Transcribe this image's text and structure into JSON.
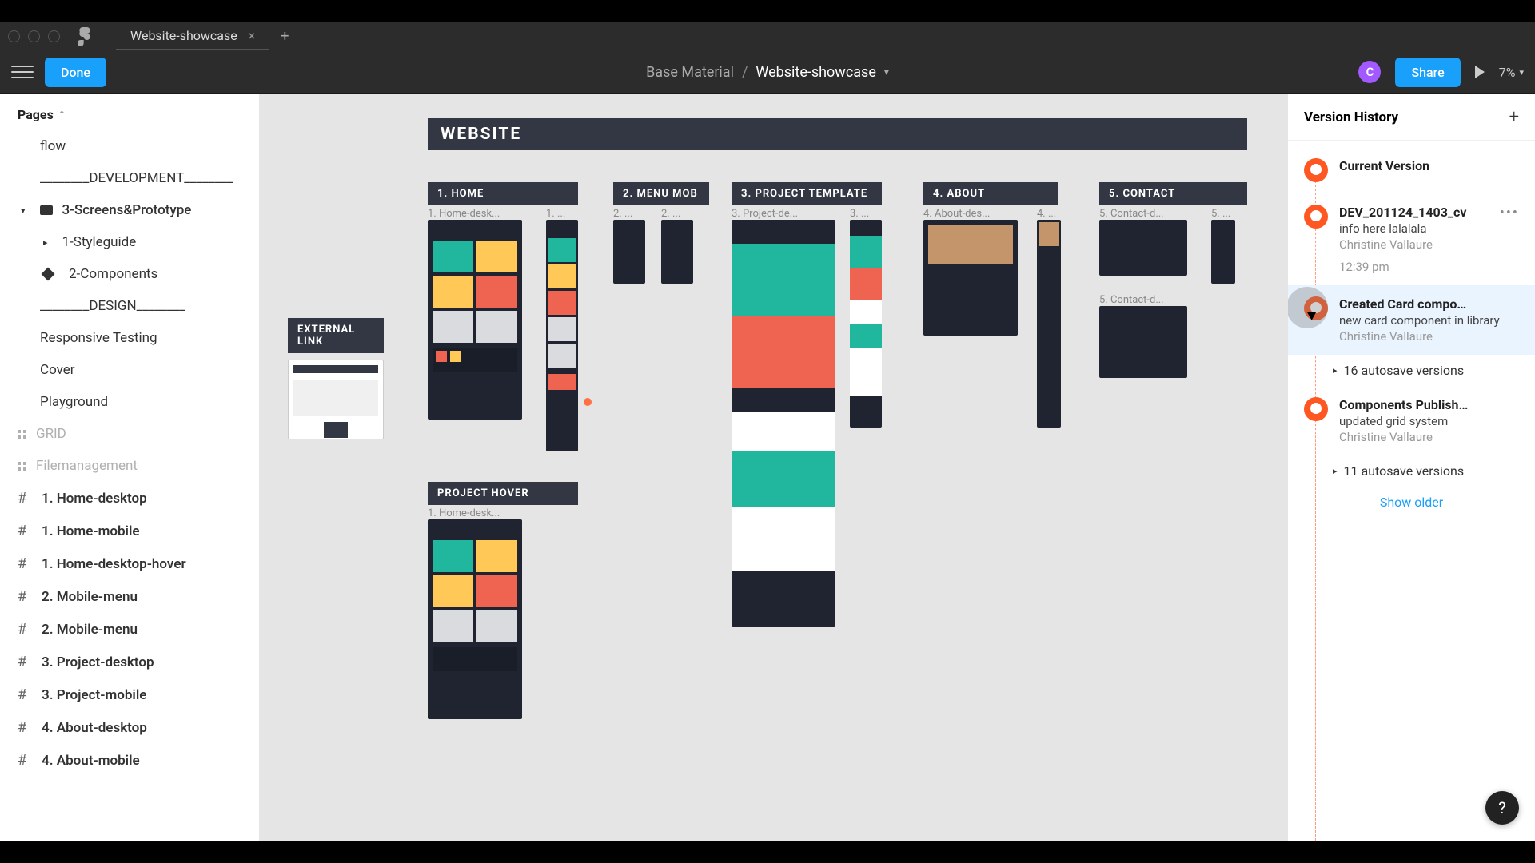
{
  "tab": {
    "title": "Website-showcase"
  },
  "toolbar": {
    "done": "Done",
    "breadcrumb_parent": "Base Material",
    "breadcrumb_current": "Website-showcase",
    "avatar_initial": "C",
    "share": "Share",
    "zoom": "7%"
  },
  "left": {
    "pages_header": "Pages",
    "pages": [
      "flow",
      "________DEVELOPMENT________",
      "3-Screens&Prototype",
      "1-Styleguide",
      "2-Components",
      "________DESIGN________",
      "Responsive Testing",
      "Cover",
      "Playground"
    ],
    "grid": "GRID",
    "filemgmt": "Filemanagement",
    "frames": [
      "1. Home-desktop",
      "1. Home-mobile",
      "1. Home-desktop-hover",
      "2. Mobile-menu",
      "2. Mobile-menu",
      "3. Project-desktop",
      "3. Project-mobile",
      "4. About-desktop",
      "4. About-mobile"
    ]
  },
  "canvas": {
    "external_link": "EXTERNAL LINK",
    "website_header": "WEBSITE",
    "sections": {
      "s1": "1. HOME",
      "s2": "2. MENU MOB",
      "s3": "3. PROJECT TEMPLATE",
      "s4": "4. ABOUT",
      "s5": "5. CONTACT"
    },
    "frame_names": {
      "f1a": "1. Home-desk...",
      "f1b": "1. ...",
      "f2a": "2. ...",
      "f2b": "2. ...",
      "f3a": "3. Project-de...",
      "f3b": "3. ...",
      "f4a": "4. About-des...",
      "f4b": "4. ...",
      "f5a": "5. Contact-d...",
      "f5b": "5. ...",
      "f5c": "5. Contact-d...",
      "fph": "1. Home-desk..."
    },
    "project_hover": "PROJECT HOVER"
  },
  "right": {
    "header": "Version History",
    "items": [
      {
        "title": "Current Version"
      },
      {
        "title": "DEV_201124_1403_cv",
        "desc": "info here lalalala",
        "author": "Christine Vallaure",
        "time": "12:39 pm"
      },
      {
        "title": "Created Card compo…",
        "desc": "new card component in library",
        "author": "Christine Vallaure"
      },
      {
        "title": "Components Publish…",
        "desc": "updated grid system",
        "author": "Christine Vallaure"
      }
    ],
    "autosave1": "16 autosave versions",
    "autosave2": "11 autosave versions",
    "show_older": "Show older"
  },
  "help": "?"
}
